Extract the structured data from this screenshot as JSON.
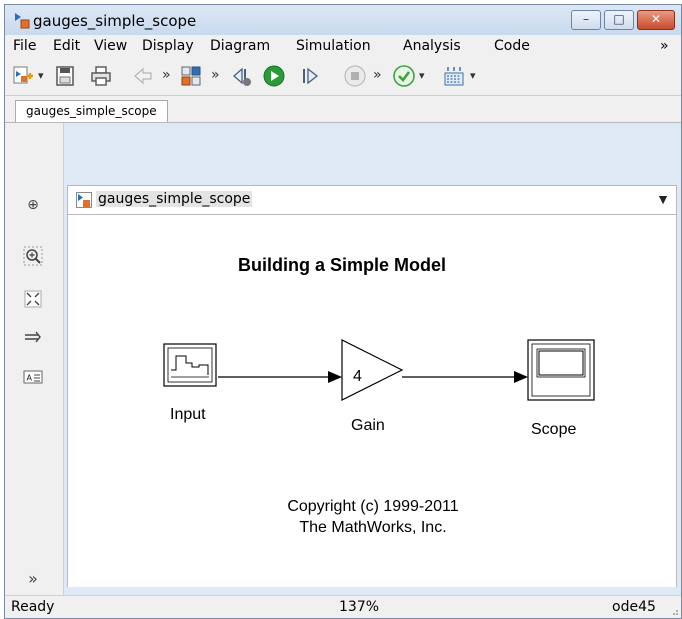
{
  "window": {
    "title": "gauges_simple_scope",
    "controls": {
      "minimize": "–",
      "maximize": "□",
      "close": "✕"
    }
  },
  "menubar": {
    "items": [
      "File",
      "Edit",
      "View",
      "Display",
      "Diagram",
      "Simulation",
      "Analysis",
      "Code"
    ],
    "overflow": "»"
  },
  "toolbar": {
    "overflow_1": "»",
    "overflow_2": "»",
    "overflow_3": "»",
    "overflow_4": "»",
    "dropdown": "▾"
  },
  "tabs": {
    "active": "gauges_simple_scope"
  },
  "address": {
    "model_name": "gauges_simple_scope",
    "dropdown": "▼"
  },
  "diagram": {
    "title": "Building a Simple Model",
    "blocks": {
      "input": {
        "label": "Input"
      },
      "gain": {
        "label": "Gain",
        "value": "4"
      },
      "scope": {
        "label": "Scope"
      }
    },
    "copyright_line1": "Copyright (c) 1999-2011",
    "copyright_line2": "The MathWorks, Inc."
  },
  "leftbar": {
    "expand": "»"
  },
  "statusbar": {
    "state": "Ready",
    "zoom": "137%",
    "solver": "ode45"
  },
  "colors": {
    "run_green": "#2a9a3a",
    "check_green": "#3fa33f",
    "close_red": "#c74a2c",
    "model_icon_orange": "#e3702a",
    "model_icon_blue": "#2d6fb6"
  }
}
